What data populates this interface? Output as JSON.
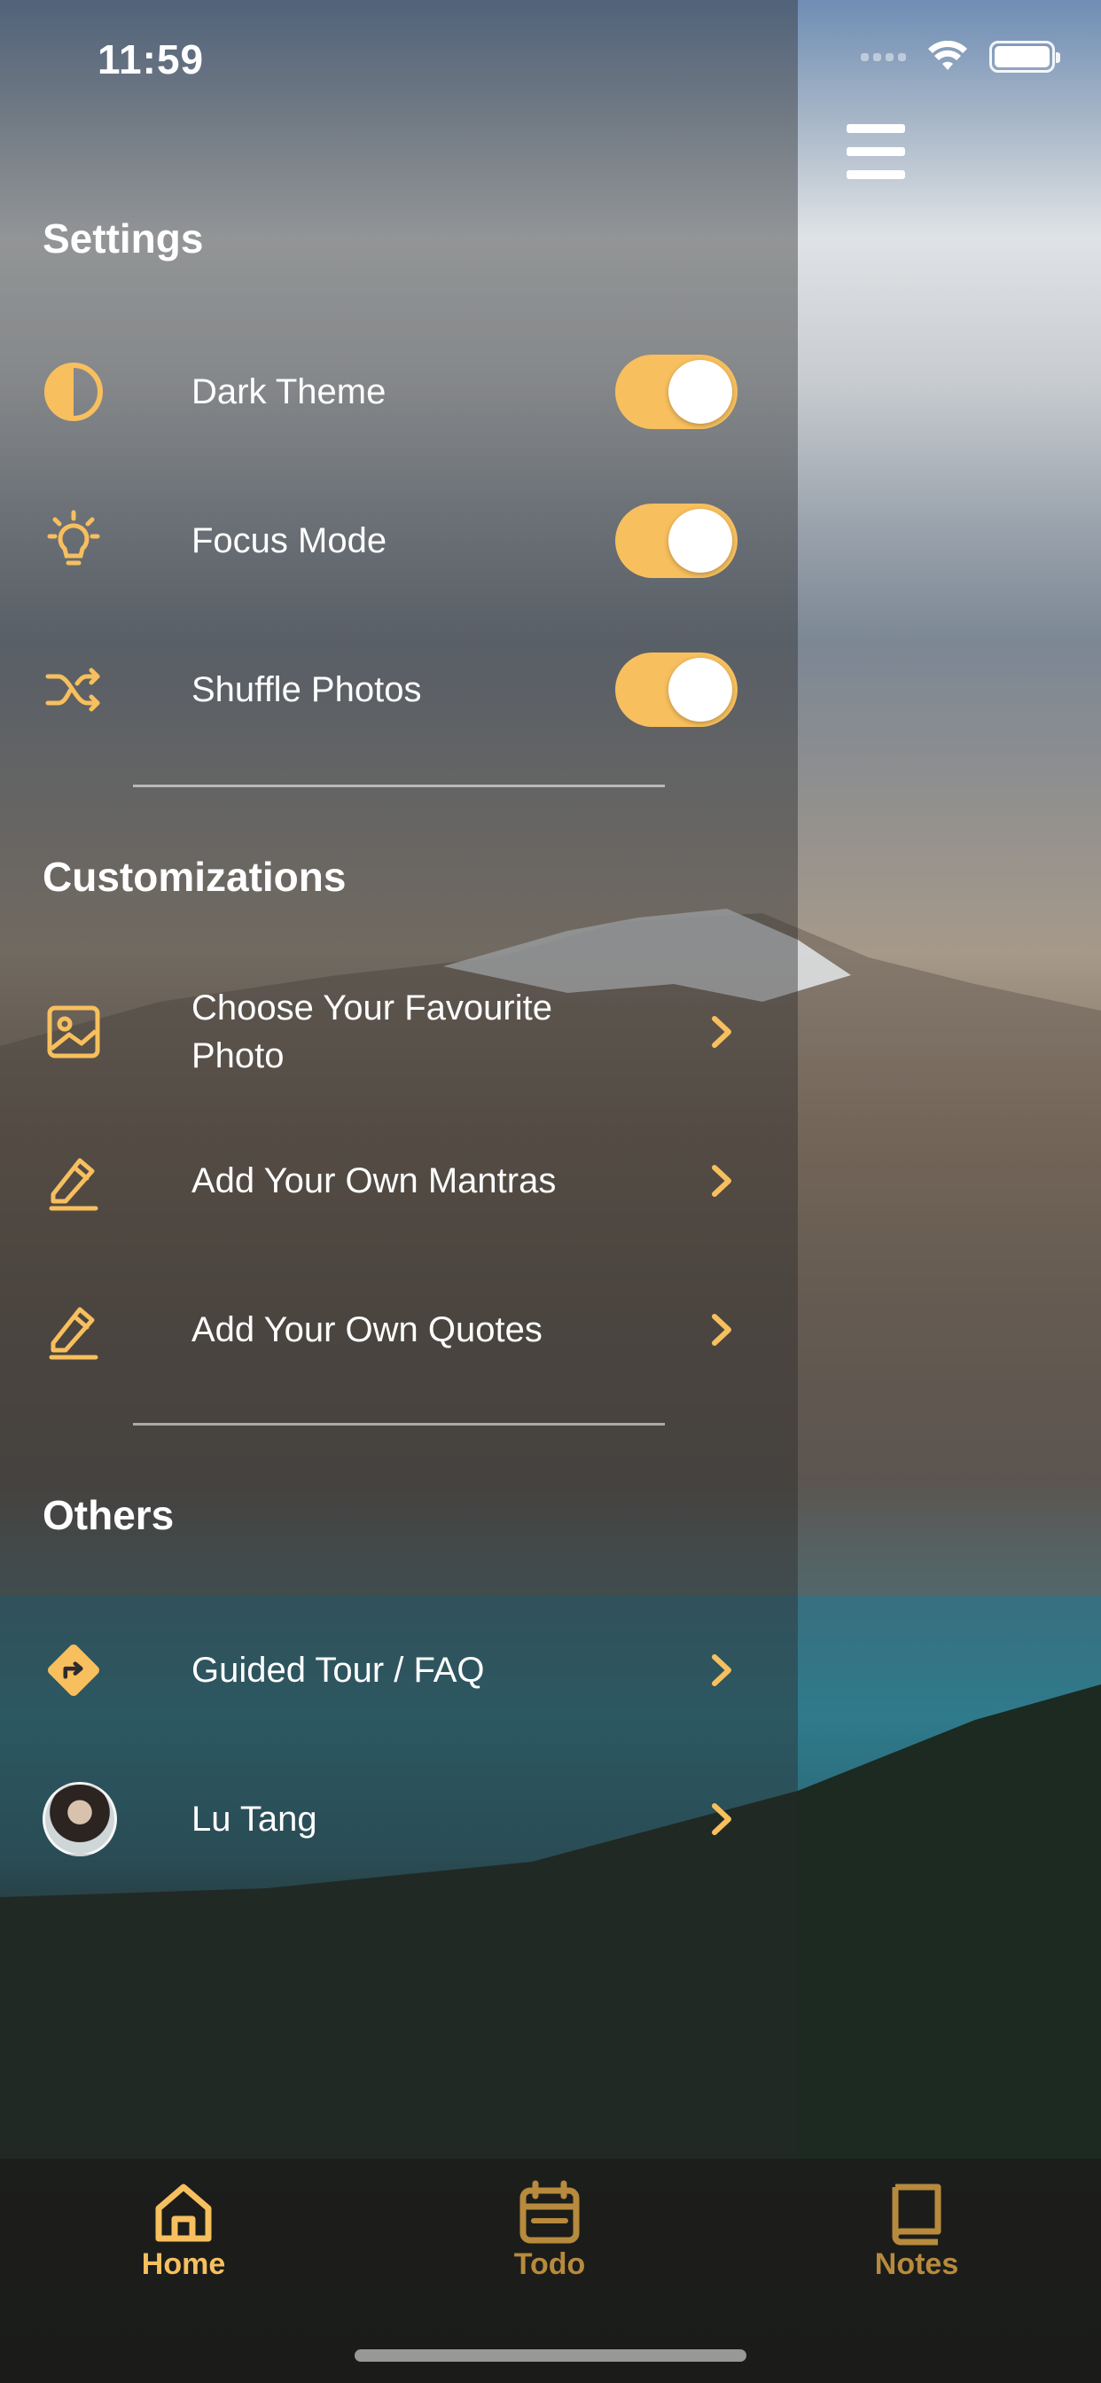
{
  "status": {
    "time": "11:59"
  },
  "colors": {
    "accent": "#f7bf5e",
    "tab_inactive": "#b78a3d"
  },
  "sections": {
    "settings": "Settings",
    "customizations": "Customizations",
    "others": "Others"
  },
  "settings": [
    {
      "label": "Dark Theme",
      "icon": "half-circle-icon",
      "enabled": true
    },
    {
      "label": "Focus Mode",
      "icon": "lightbulb-icon",
      "enabled": true
    },
    {
      "label": "Shuffle Photos",
      "icon": "shuffle-icon",
      "enabled": true
    }
  ],
  "customizations": [
    {
      "label_line1": "Choose Your Favourite",
      "label_line2": "Photo",
      "icon": "image-icon"
    },
    {
      "label": "Add Your Own Mantras",
      "icon": "pencil-icon"
    },
    {
      "label": "Add Your Own Quotes",
      "icon": "pencil-icon"
    }
  ],
  "others": [
    {
      "label": "Guided Tour / FAQ",
      "icon": "directions-icon"
    },
    {
      "label": "Lu Tang",
      "icon": "avatar"
    }
  ],
  "tabs": [
    {
      "label": "Home",
      "icon": "home-icon",
      "active": true
    },
    {
      "label": "Todo",
      "icon": "calendar-icon",
      "active": false
    },
    {
      "label": "Notes",
      "icon": "book-icon",
      "active": false
    }
  ]
}
